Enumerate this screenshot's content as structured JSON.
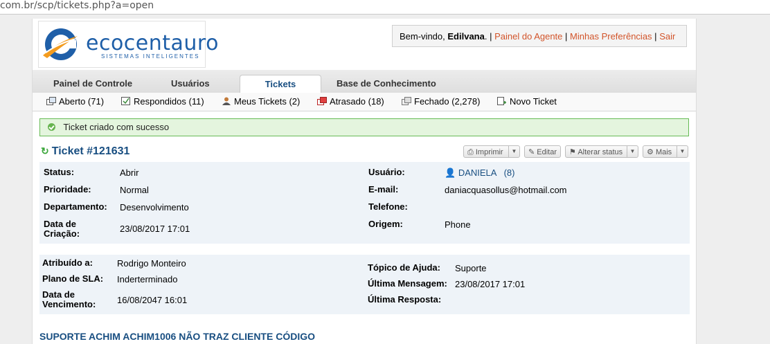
{
  "browser": {
    "url_path": "com.br/scp/tickets.php?a=open"
  },
  "header": {
    "logo_name": "ecocentauro",
    "logo_tagline": "SISTEMAS INTELIGENTES",
    "welcome_prefix": "Bem-vindo,",
    "user_name": "Edilvana",
    "agent_panel": "Painel do Agente",
    "preferences": "Minhas Preferências",
    "logout": "Sair"
  },
  "tabs": [
    {
      "label": "Painel de Controle"
    },
    {
      "label": "Usuários"
    },
    {
      "label": "Tickets"
    },
    {
      "label": "Base de Conhecimento"
    }
  ],
  "subnav": [
    {
      "label": "Aberto (71)",
      "icon": "open-tickets-icon"
    },
    {
      "label": "Respondidos (11)",
      "icon": "answered-icon"
    },
    {
      "label": "Meus Tickets (2)",
      "icon": "my-tickets-icon"
    },
    {
      "label": "Atrasado (18)",
      "icon": "overdue-icon"
    },
    {
      "label": "Fechado (2,278)",
      "icon": "closed-icon"
    },
    {
      "label": "Novo Ticket",
      "icon": "new-ticket-icon"
    }
  ],
  "alert": {
    "message": "Ticket criado com sucesso"
  },
  "ticket": {
    "title": "Ticket #121631",
    "actions": {
      "print": "Imprimir",
      "edit": "Editar",
      "status": "Alterar status",
      "more": "Mais"
    },
    "status_label": "Status:",
    "status_value": "Abrir",
    "priority_label": "Prioridade:",
    "priority_value": "Normal",
    "department_label": "Departamento:",
    "department_value": "Desenvolvimento",
    "created_label": "Data de Criação:",
    "created_value": "23/08/2017 17:01",
    "user_label": "Usuário:",
    "user_value": "DANIELA",
    "user_count": "(8)",
    "email_label": "E-mail:",
    "email_value": "daniacquasollus@hotmail.com",
    "phone_label": "Telefone:",
    "phone_value": "",
    "origin_label": "Origem:",
    "origin_value": "Phone",
    "assigned_label": "Atribuído a:",
    "assigned_value": "Rodrigo Monteiro",
    "sla_label": "Plano de SLA:",
    "sla_value": "Inderterminado",
    "due_label": "Data de Vencimento:",
    "due_value": "16/08/2047 16:01",
    "topic_label": "Tópico de Ajuda:",
    "topic_value": "Suporte",
    "last_msg_label": "Última Mensagem:",
    "last_msg_value": "23/08/2017 17:01",
    "last_resp_label": "Última Resposta:",
    "last_resp_value": "",
    "subject": "SUPORTE ACHIM ACHIM1006 NÃO TRAZ CLIENTE CÓDIGO"
  },
  "colors": {
    "link": "#184e81",
    "accent": "#d2542a",
    "success_bg": "#e4f5de"
  }
}
